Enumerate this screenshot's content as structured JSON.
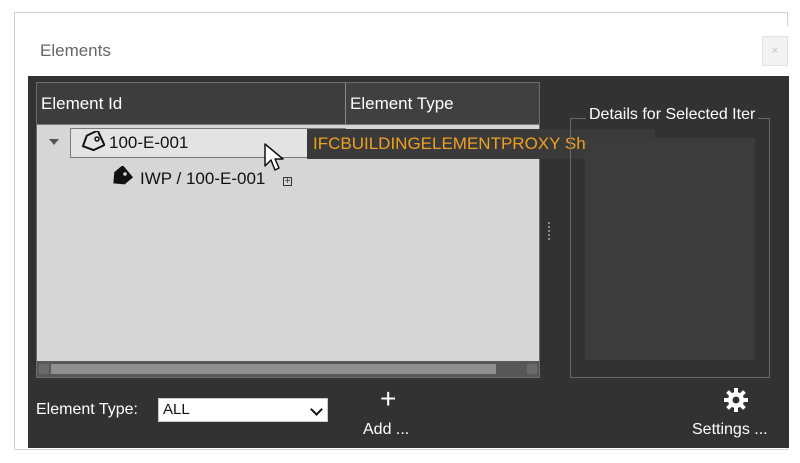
{
  "window": {
    "title": "Elements",
    "close_symbol": "×"
  },
  "tree": {
    "columns": [
      "Element Id",
      "Element Type"
    ],
    "rows": [
      {
        "label": "100-E-001",
        "icon": "tag-outline-icon",
        "expanded": true,
        "selected": true
      },
      {
        "label": "IWP / 100-E-001",
        "icon": "tag-filled-icon",
        "expand_symbol": "+"
      }
    ]
  },
  "tooltip": {
    "text": "IFCBUILDINGELEMENTPROXY Shape ..."
  },
  "details": {
    "legend": "Details for Selected Iter"
  },
  "footer": {
    "type_label": "Element Type:",
    "type_value": "ALL",
    "add_symbol": "+",
    "add_label": "Add ...",
    "settings_label": "Settings ..."
  },
  "colors": {
    "panel_bg": "#323232",
    "tooltip_text": "#f0a020",
    "tree_bg": "#d6d6d6"
  }
}
